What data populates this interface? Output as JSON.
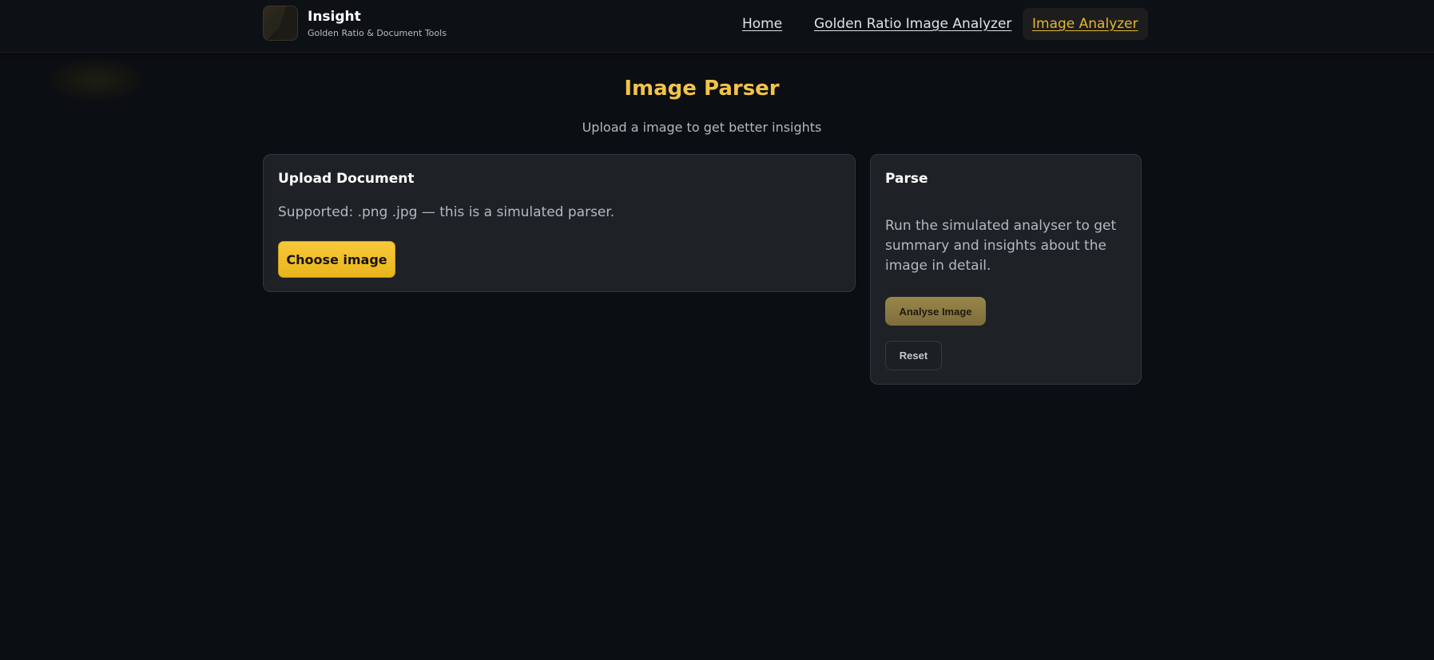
{
  "brand": {
    "title": "Insight",
    "subtitle": "Golden Ratio & Document Tools",
    "logo_icon": "golden-ratio-logo"
  },
  "nav": {
    "items": [
      {
        "label": "Home",
        "active": false
      },
      {
        "label": "Golden Ratio Image Analyzer",
        "active": false
      },
      {
        "label": "Image Analyzer",
        "active": true
      }
    ]
  },
  "page": {
    "title": "Image Parser",
    "subtitle": "Upload a image to get better insights"
  },
  "upload_card": {
    "title": "Upload Document",
    "note": "Supported: .png .jpg — this is a simulated parser.",
    "choose_label": "Choose image"
  },
  "parse_card": {
    "title": "Parse",
    "description": "Run the simulated analyser to get summary and insights about the image in detail.",
    "analyse_label": "Analyse Image",
    "reset_label": "Reset"
  },
  "colors": {
    "background": "#0b0e12",
    "accent": "#f2c34a",
    "card": "#1e2126",
    "button_primary": "#f8c93b"
  }
}
